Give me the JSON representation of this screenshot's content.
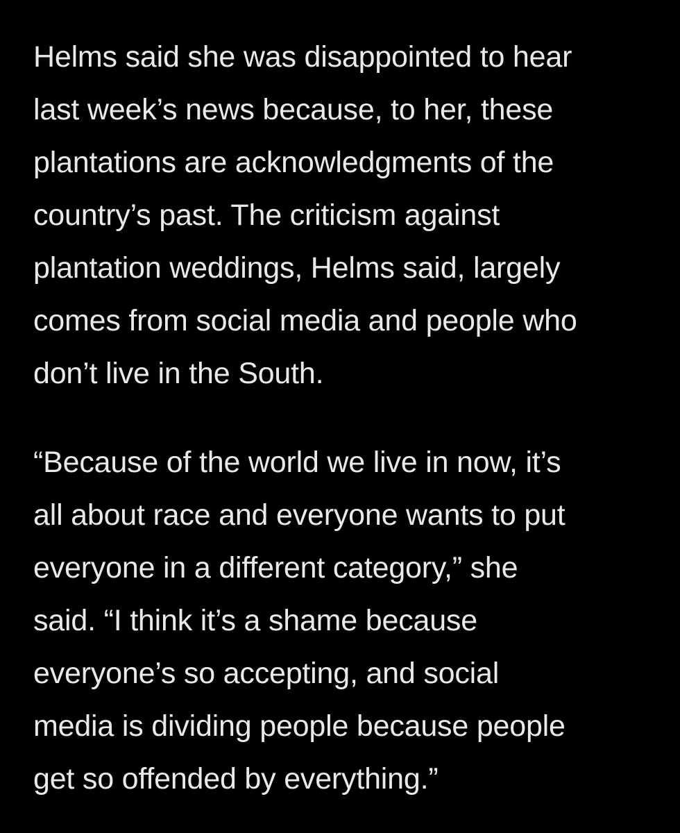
{
  "colors": {
    "background": "#000000",
    "text": "#e9e9e9"
  },
  "article": {
    "paragraphs": [
      "Helms said she was disappointed to hear\nlast week’s news because, to her, these\nplantations are acknowledgments of the\ncountry’s past. The criticism against\nplantation weddings, Helms said, largely\ncomes from social media and people who\ndon’t live in the South.",
      "“Because of the world we live in now, it’s\nall about race and everyone wants to put\neveryone in a different category,” she\nsaid. “I think it’s a shame because\neveryone’s so accepting, and social\nmedia is dividing people because people\nget so offended by everything.”"
    ]
  }
}
